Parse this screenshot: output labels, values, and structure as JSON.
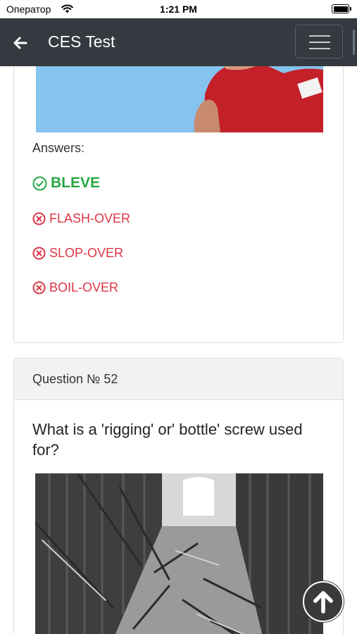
{
  "status_bar": {
    "carrier": "Оператор",
    "time": "1:21 PM"
  },
  "navbar": {
    "title": "CES Test"
  },
  "previous_question": {
    "answers_label": "Answers:",
    "answers": [
      {
        "text": "BLEVE",
        "correct": true
      },
      {
        "text": "FLASH-OVER",
        "correct": false
      },
      {
        "text": "SLOP-OVER",
        "correct": false
      },
      {
        "text": "BOIL-OVER",
        "correct": false
      }
    ]
  },
  "question": {
    "header": "Question № 52",
    "text": "What is a 'rigging' or' bottle' screw used for?"
  },
  "colors": {
    "navbar": "#343a40",
    "correct": "#28a745",
    "wrong": "#dc3545"
  }
}
